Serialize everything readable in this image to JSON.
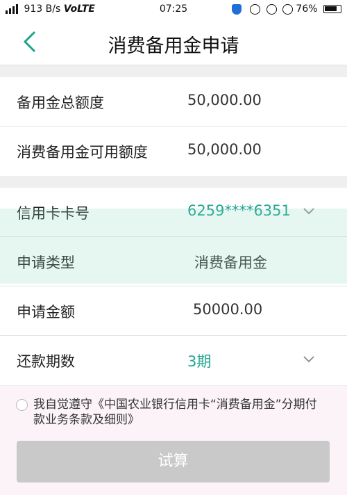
{
  "status_bar": {
    "net_speed": "913 B/s",
    "volte": "VoLTE",
    "time": "07:25",
    "battery": "76%"
  },
  "header": {
    "title": "消费备用金申请"
  },
  "quota": {
    "total_label": "备用金总额度",
    "total_value": "50,000.00",
    "available_label": "消费备用金可用额度",
    "available_value": "50,000.00"
  },
  "form": {
    "card_label": "信用卡卡号",
    "card_value": "6259****6351",
    "type_label": "申请类型",
    "type_value": "消费备用金",
    "amount_label": "申请金额",
    "amount_value": "50000.00",
    "term_label": "还款期数",
    "term_value": "3期"
  },
  "agreement": {
    "text": "我自觉遵守《中国农业银行信用卡“消费备用金”分期付款业务条款及细则》"
  },
  "actions": {
    "calc_label": "试算"
  },
  "colors": {
    "accent": "#1ea38e",
    "button_disabled": "#c9c9c9"
  }
}
